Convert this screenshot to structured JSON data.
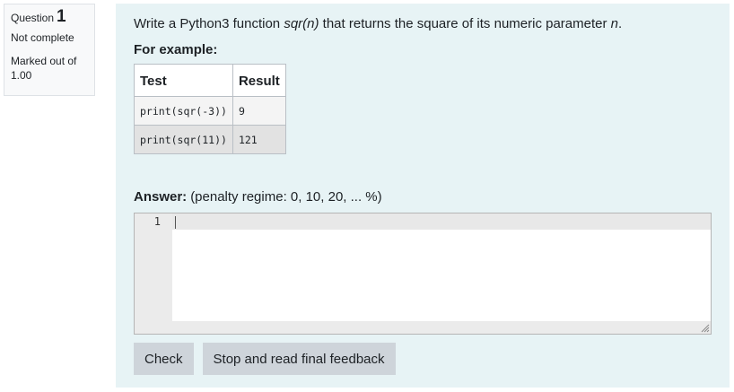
{
  "question_info": {
    "label": "Question",
    "number": "1",
    "state": "Not complete",
    "grade": "Marked out of 1.00"
  },
  "question": {
    "text_prefix": "Write a Python3 function ",
    "function_sig": "sqr(n)",
    "text_middle": " that returns the square of its numeric parameter ",
    "param": "n",
    "text_suffix": ".",
    "for_example": "For example:"
  },
  "examples": {
    "headers": [
      "Test",
      "Result"
    ],
    "rows": [
      {
        "test": "print(sqr(-3))",
        "result": "9"
      },
      {
        "test": "print(sqr(11))",
        "result": "121"
      }
    ]
  },
  "answer": {
    "label": "Answer:",
    "penalty": "(penalty regime: 0, 10, 20, ... %)",
    "line_number": "1",
    "code": ""
  },
  "buttons": {
    "check": "Check",
    "finish": "Stop and read final feedback"
  }
}
